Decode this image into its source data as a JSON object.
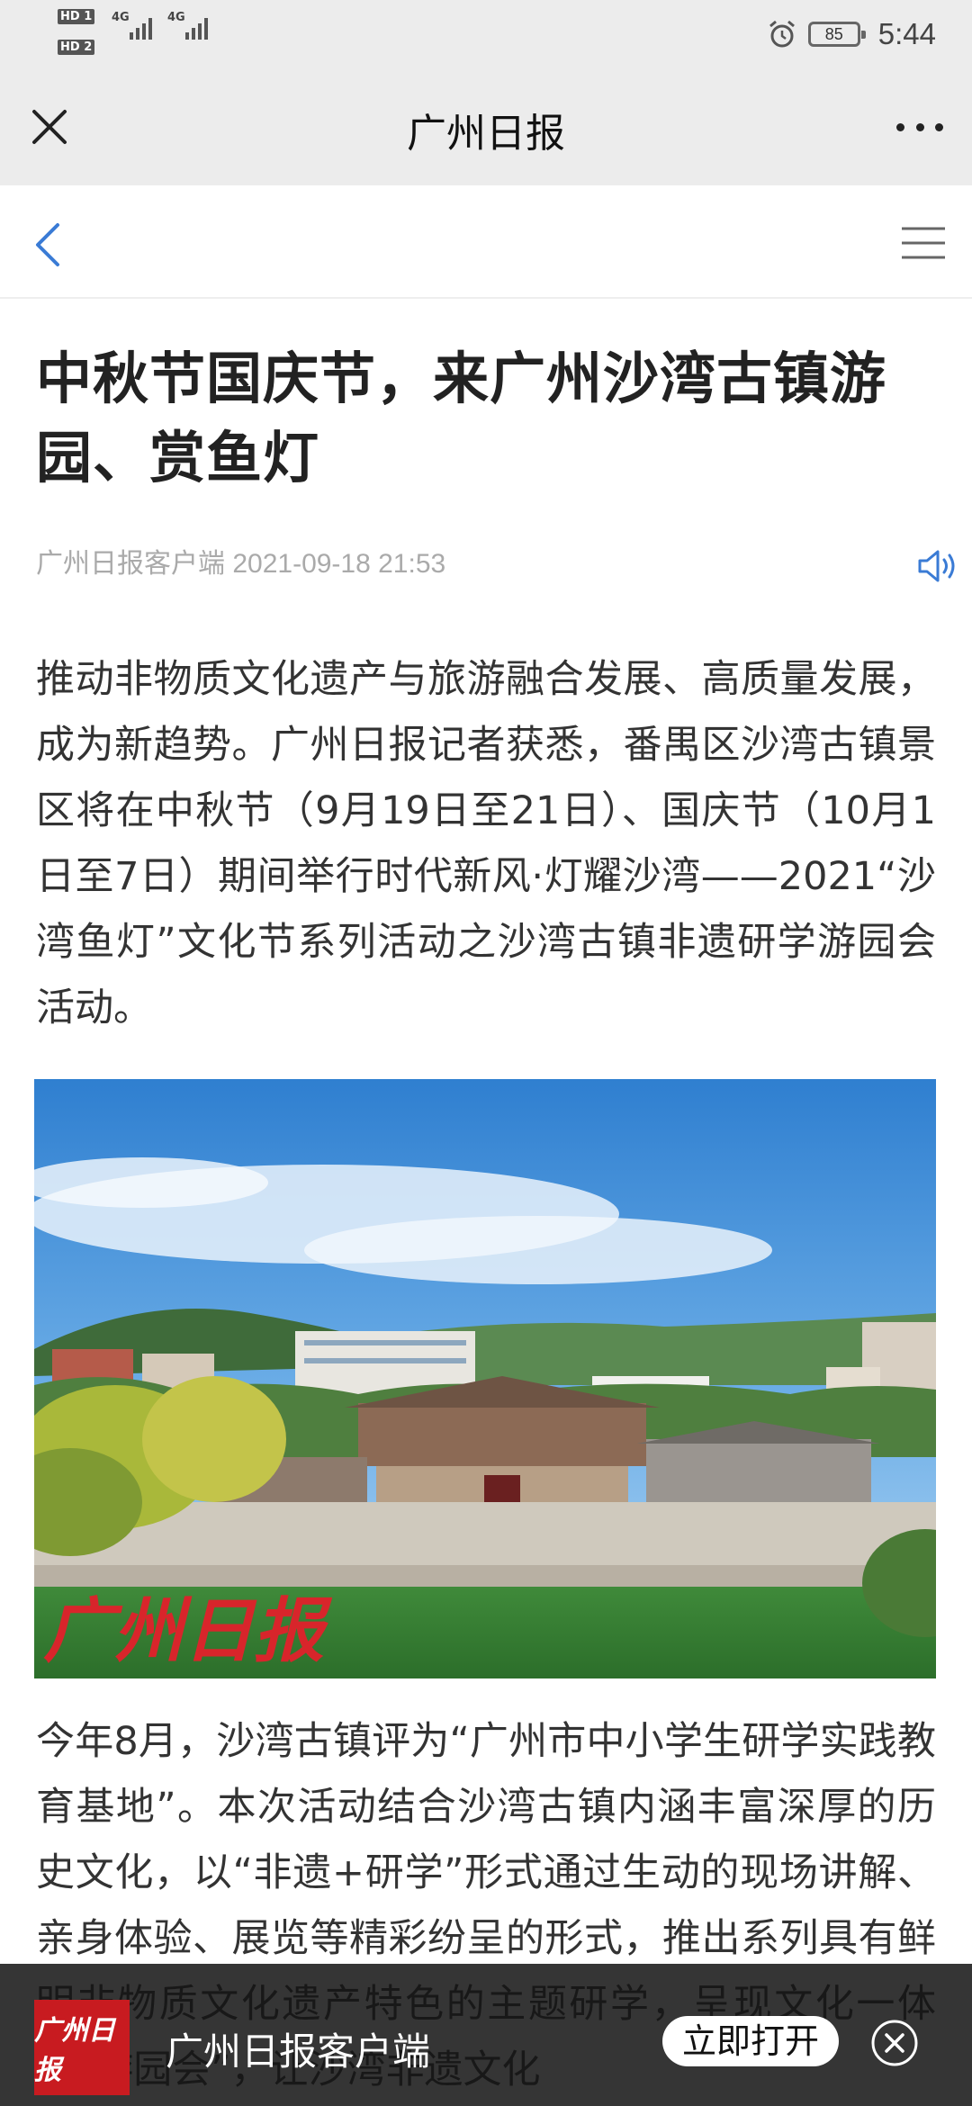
{
  "status_bar": {
    "hd1": "HD 1",
    "hd2": "HD 2",
    "net1": "4G",
    "net2": "4G",
    "battery": "85",
    "time": "5:44"
  },
  "app_bar": {
    "title": "广州日报",
    "close_icon": "close-icon",
    "more_icon": "more-icon"
  },
  "nav": {
    "back_icon": "chevron-left-icon",
    "menu_icon": "menu-icon",
    "accent_color": "#3a7bd5"
  },
  "article": {
    "title": "中秋节国庆节，来广州沙湾古镇游园、赏鱼灯",
    "source": "广州日报客户端 2021-09-18 21:53",
    "speaker_icon": "speaker-icon",
    "paragraph1": "推动非物质文化遗产与旅游融合发展、高质量发展，成为新趋势。广州日报记者获悉，番禺区沙湾古镇景区将在中秋节（9月19日至21日）、国庆节（10月1日至7日）期间举行时代新风·灯耀沙湾——2021“沙湾鱼灯”文化节系列活动之沙湾古镇非遗研学游园会活动。",
    "photo_watermark": "广州日报",
    "paragraph2": "今年8月，沙湾古镇评为“广州市中小学生研学实践教育基地”。本次活动结合沙湾古镇内涵丰富深厚的历史文化，以“非遗+研学”形式通过生动的现场讲解、亲身体验、展览等精彩纷呈的形式，推出系列具有鲜明非物质文化遗产特色的主题研学，呈现文化一体式“游园会”，让沙湾非遗文化"
  },
  "banner": {
    "logo_text": "广州日报",
    "app_name": "广州日报客户端",
    "open_label": "立即打开",
    "close_icon": "close-circle-icon"
  }
}
